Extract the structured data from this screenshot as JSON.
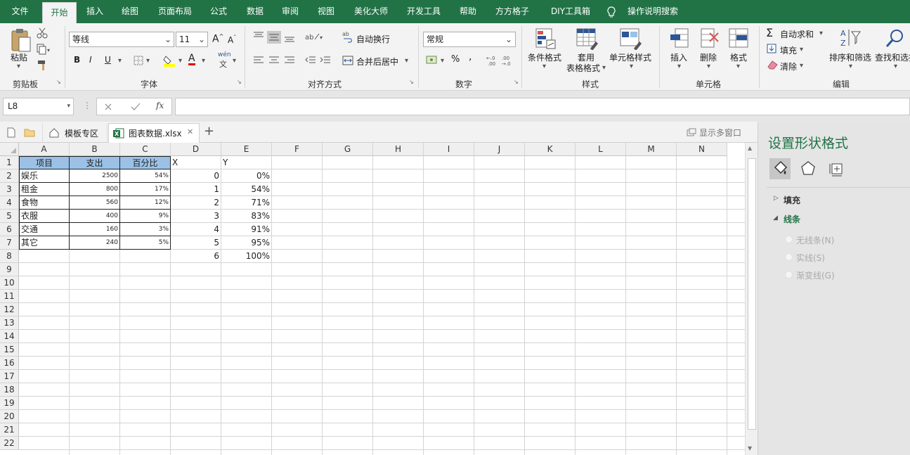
{
  "menu": {
    "tabs": [
      "文件",
      "开始",
      "插入",
      "绘图",
      "页面布局",
      "公式",
      "数据",
      "审阅",
      "视图",
      "美化大师",
      "开发工具",
      "帮助",
      "方方格子",
      "DIY工具箱",
      "操作说明搜索"
    ],
    "active": "开始"
  },
  "ribbon": {
    "clipboard": {
      "paste": "粘贴",
      "group": "剪贴板"
    },
    "font": {
      "name": "等线",
      "size": "11",
      "bold": "B",
      "italic": "I",
      "underline": "U",
      "grow": "A",
      "shrink": "A",
      "color_letter": "A",
      "pinyin": "wén",
      "group": "字体"
    },
    "alignment": {
      "wrap": "自动换行",
      "merge": "合并后居中",
      "group": "对齐方式"
    },
    "number": {
      "format": "常规",
      "percent": "%",
      "comma": ",",
      "group": "数字"
    },
    "styles": {
      "conditional": "条件格式",
      "table_line1": "套用",
      "table_line2": "表格格式",
      "cell_styles": "单元格样式",
      "group": "样式"
    },
    "cells": {
      "insert": "插入",
      "delete": "删除",
      "format": "格式",
      "group": "单元格"
    },
    "editing": {
      "autosum": "自动求和",
      "fill": "填充",
      "clear": "清除",
      "sort": "排序和筛选",
      "find": "查找和选择",
      "group": "编辑"
    }
  },
  "formula_bar": {
    "name_box": "L8",
    "fx": "fx",
    "value": ""
  },
  "file_tabs": {
    "template": "模板专区",
    "file": "图表数据.xlsx",
    "add": "+",
    "multi_window": "显示多窗口"
  },
  "grid": {
    "columns": [
      "A",
      "B",
      "C",
      "D",
      "E",
      "F",
      "G",
      "H",
      "I",
      "J",
      "K",
      "L",
      "M",
      "N"
    ],
    "rows": [
      "1",
      "2",
      "3",
      "4",
      "5",
      "6",
      "7",
      "8",
      "9",
      "10",
      "11",
      "12",
      "13",
      "14",
      "15",
      "16",
      "17",
      "18",
      "19",
      "20",
      "21",
      "22"
    ],
    "headers": {
      "a": "项目",
      "b": "支出",
      "c": "百分比",
      "d": "X",
      "e": "Y"
    },
    "table": [
      {
        "a": "娱乐",
        "b": "2500",
        "c": "54%",
        "d": "0",
        "e": "0%"
      },
      {
        "a": "租金",
        "b": "800",
        "c": "17%",
        "d": "1",
        "e": "54%"
      },
      {
        "a": "食物",
        "b": "560",
        "c": "12%",
        "d": "2",
        "e": "71%"
      },
      {
        "a": "衣服",
        "b": "400",
        "c": "9%",
        "d": "3",
        "e": "83%"
      },
      {
        "a": "交通",
        "b": "160",
        "c": "3%",
        "d": "4",
        "e": "91%"
      },
      {
        "a": "其它",
        "b": "240",
        "c": "5%",
        "d": "5",
        "e": "95%"
      },
      {
        "a": "",
        "b": "",
        "c": "",
        "d": "6",
        "e": "100%"
      }
    ]
  },
  "format_panel": {
    "title": "设置形状格式",
    "fill": "填充",
    "line": "线条",
    "options": [
      "无线条(N)",
      "实线(S)",
      "渐变线(G)"
    ]
  },
  "colors": {
    "excel_green": "#217346",
    "header_fill": "#9bc2e6",
    "panel_bg": "#e5e5e5"
  }
}
